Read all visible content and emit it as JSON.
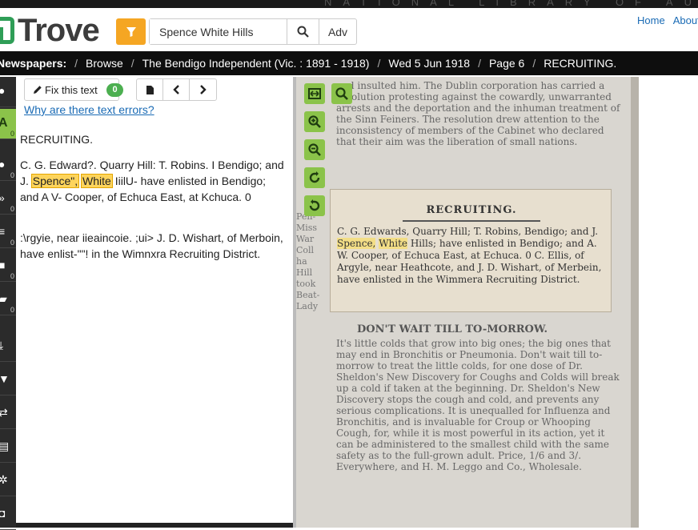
{
  "header": {
    "banner": "NATIONAL LIBRARY OF AUSTRALIA",
    "logo_text": "Trove",
    "search": {
      "value": "Spence White Hills",
      "adv_label": "Adv"
    },
    "links": [
      "Home",
      "About"
    ]
  },
  "breadcrumb": [
    "Newspapers:",
    "Browse",
    "The Bendigo Independent (Vic. : 1891 - 1918)",
    "Wed 5 Jun 1918",
    "Page 6",
    "RECRUITING."
  ],
  "sidebar": {
    "items": [
      {
        "icon": "info-icon",
        "glyph": "●",
        "count": ""
      },
      {
        "icon": "text-icon",
        "glyph": "A",
        "count": "0"
      },
      {
        "icon": "comment-icon",
        "glyph": "●",
        "count": "0"
      },
      {
        "icon": "tag-icon",
        "glyph": "»",
        "count": "0"
      },
      {
        "icon": "list-icon",
        "glyph": "≡",
        "count": "0"
      },
      {
        "icon": "note-icon",
        "glyph": "■",
        "count": "0"
      },
      {
        "icon": "archive-icon",
        "glyph": "▰",
        "count": "0"
      },
      {
        "icon": "download-icon",
        "glyph": "⤓",
        "count": ""
      },
      {
        "icon": "cart-icon",
        "glyph": "▼",
        "count": ""
      },
      {
        "icon": "share-icon",
        "glyph": "⇄",
        "count": ""
      },
      {
        "icon": "print-icon",
        "glyph": "▤",
        "count": ""
      },
      {
        "icon": "settings-icon",
        "glyph": "✲",
        "count": ""
      },
      {
        "icon": "help-icon",
        "glyph": "◘",
        "count": ""
      }
    ]
  },
  "textpanel": {
    "fix_label": "Fix this text",
    "fix_count": "0",
    "error_link": "Why are there text errors?",
    "title": "RECRUITING.",
    "para1_pre": "C. G. Edward?. Quarry Hill: T. Robins. I Bendigo; and J. ",
    "para1_hl1": "Spence\",",
    "para1_hl2": "White",
    "para1_post": " IiilU- have enlisted in Bendigo; and A V- Cooper, of Echuca East, at Kchuca. 0",
    "para2": ":\\rgyie, near iieaincoie. ;ui> J. D. Wishart, of Merboin, have enlist-\"\"! in the Wimnxra Recruiting District."
  },
  "viewer": {
    "clip_title": "RECRUITING.",
    "clip_pre": "C. G. Edwards, Quarry Hill; T. Robins, Bendigo; and J. ",
    "clip_hl1": "Spence,",
    "clip_hl2": "White",
    "clip_post": " Hills; have enlisted in Bendigo; and A. W. Cooper, of Echuca East, at Echuca. 0 C. Ellis, of Argyle, near Heathcote, and J. D. Wishart, of Merbein, have enlisted in the Wimmera Recruiting District.",
    "top_text": "and insulted him. The Dublin corporation has carried a resolution protesting against the cowardly, unwarranted arrests and the deportation and the inhuman treatment of the Sinn Feiners. The resolution drew attention to the inconsistency of members of the Cabinet who declared that their aim was the liberation of small nations.",
    "ad_head": "DON'T WAIT TILL TO-MORROW.",
    "ad_text": "It's little colds that grow into big ones; the big ones that may end in Bronchitis or Pneumonia. Don't wait till to-morrow to treat the little colds, for one dose of Dr. Sheldon's New Discovery for Coughs and Colds will break up a cold if taken at the beginning. Dr. Sheldon's New Discovery stops the cough and cold, and prevents any serious complications. It is unequalled for Influenza and Bronchitis, and is invaluable for Croup or Whooping Cough, for, while it is most powerful in its action, yet it can be administered to the smallest child with the same safety as to the full-grown adult. Price, 1/6 and 3/. Everywhere, and H. M. Leggo and Co., Wholesale."
  }
}
